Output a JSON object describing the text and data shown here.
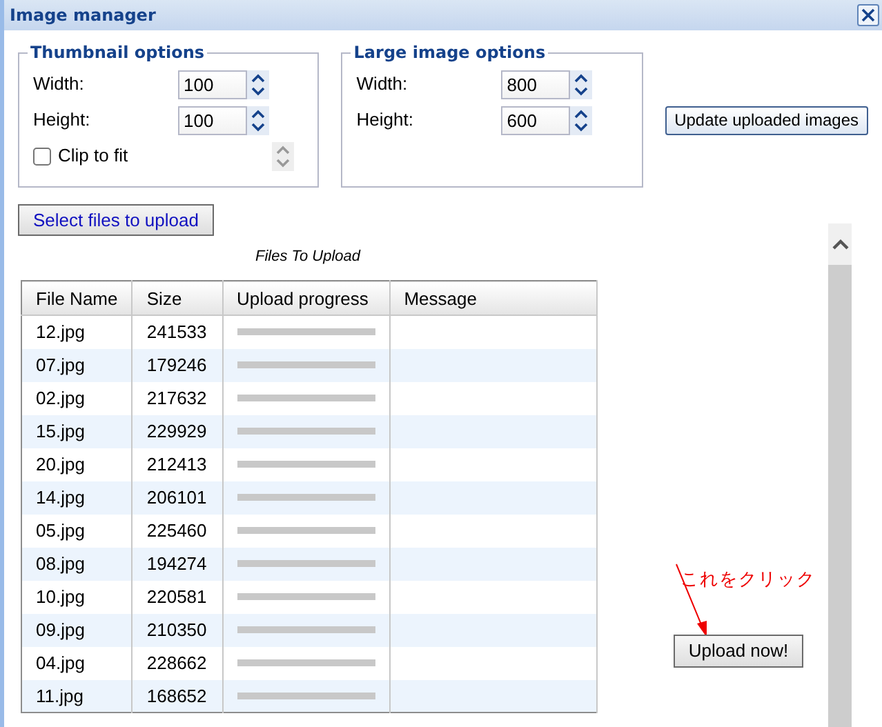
{
  "window": {
    "title": "Image manager"
  },
  "thumbnail_options": {
    "legend": "Thumbnail options",
    "fields": [
      {
        "label": "Width:",
        "value": "100"
      },
      {
        "label": "Height:",
        "value": "100"
      }
    ],
    "clip_to_fit": {
      "label": "Clip to fit",
      "checked": false
    }
  },
  "large_image_options": {
    "legend": "Large image options",
    "fields": [
      {
        "label": "Width:",
        "value": "800"
      },
      {
        "label": "Height:",
        "value": "600"
      }
    ]
  },
  "update_button": "Update uploaded images",
  "select_button": "Select files to upload",
  "table_caption": "Files To Upload",
  "table": {
    "columns": [
      "File Name",
      "Size",
      "Upload progress",
      "Message"
    ],
    "rows": [
      {
        "file": "12.jpg",
        "size": "241533",
        "level": 0
      },
      {
        "file": "07.jpg",
        "size": "179246",
        "level": 0
      },
      {
        "file": "02.jpg",
        "size": "217632",
        "level": 0
      },
      {
        "file": "15.jpg",
        "size": "229929",
        "level": 0
      },
      {
        "file": "20.jpg",
        "size": "212413",
        "level": 0
      },
      {
        "file": "14.jpg",
        "size": "206101",
        "level": 0
      },
      {
        "file": "05.jpg",
        "size": "225460",
        "level": 0
      },
      {
        "file": "08.jpg",
        "size": "194274",
        "level": 0
      },
      {
        "file": "10.jpg",
        "size": "220581",
        "level": 0
      },
      {
        "file": "09.jpg",
        "size": "210350",
        "level": 0
      },
      {
        "file": "04.jpg",
        "size": "228662",
        "level": 0
      },
      {
        "file": "11.jpg",
        "size": "168652",
        "level": 0
      }
    ]
  },
  "annotation": "これをクリック",
  "upload_button": "Upload now!"
}
